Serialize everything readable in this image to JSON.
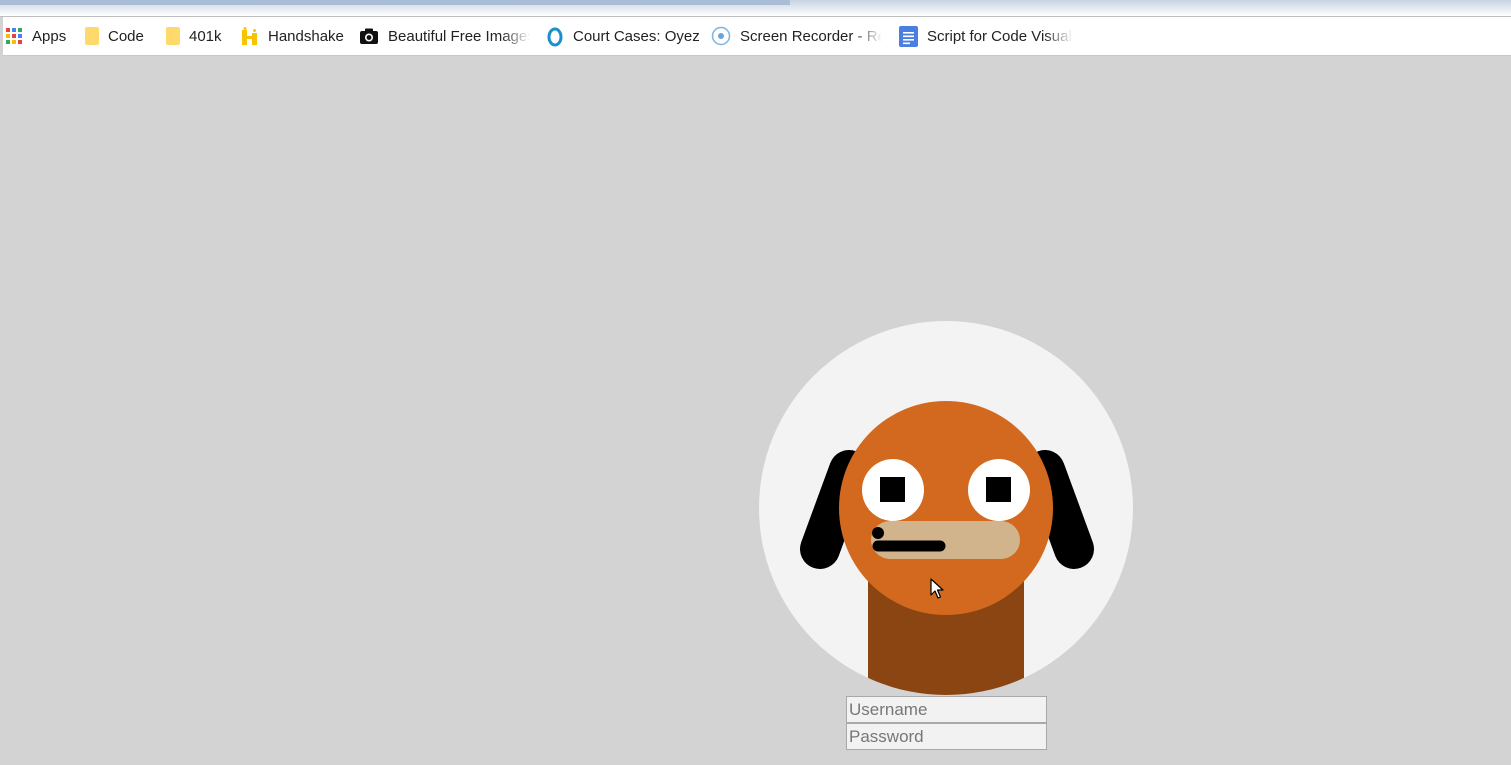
{
  "bookmarks_bar": {
    "items": [
      {
        "label": "Apps",
        "icon": "apps-grid-icon"
      },
      {
        "label": "Code",
        "icon": "folder-icon"
      },
      {
        "label": "401k",
        "icon": "folder-icon"
      },
      {
        "label": "Handshake",
        "icon": "handshake-icon"
      },
      {
        "label": "Beautiful Free Images",
        "icon": "camera-icon"
      },
      {
        "label": "Court Cases: Oyez",
        "icon": "oyez-icon"
      },
      {
        "label": "Screen Recorder - Re",
        "icon": "record-icon"
      },
      {
        "label": "Script for Code Visual",
        "icon": "google-docs-icon"
      }
    ]
  },
  "login": {
    "username_placeholder": "Username",
    "password_placeholder": "Password"
  },
  "colors": {
    "page_background": "#d3d3d3",
    "avatar_circle": "#f3f3f3",
    "dog_head": "#d2691e",
    "dog_neck": "#8b4513",
    "dog_snout": "#d2b48c",
    "dog_ears": "#000000",
    "dog_eyes": "#ffffff"
  }
}
